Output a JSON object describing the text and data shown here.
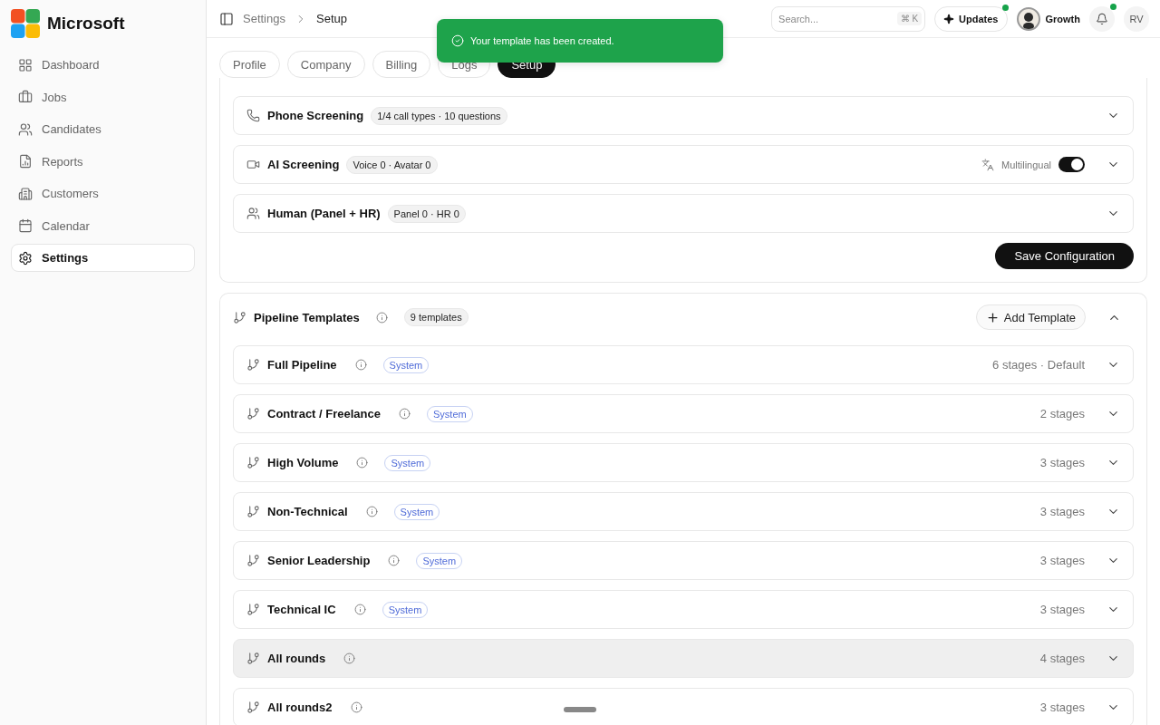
{
  "brand": "Microsoft",
  "sidebar": {
    "items": [
      {
        "label": "Dashboard",
        "selected": false
      },
      {
        "label": "Jobs",
        "selected": false
      },
      {
        "label": "Candidates",
        "selected": false
      },
      {
        "label": "Reports",
        "selected": false
      },
      {
        "label": "Customers",
        "selected": false
      },
      {
        "label": "Calendar",
        "selected": false
      },
      {
        "label": "Settings",
        "selected": true
      }
    ]
  },
  "header": {
    "breadcrumb": [
      "Settings",
      "Setup"
    ],
    "search": {
      "placeholder": "Search...",
      "shortcut": "⌘ K"
    },
    "updates": {
      "label": "Updates",
      "unread": true
    },
    "workspace": "Growth",
    "notifications_unread": true,
    "user_initials": "RV"
  },
  "toast": {
    "message": "Your template has been created."
  },
  "tabs": [
    {
      "label": "Profile",
      "selected": false
    },
    {
      "label": "Company",
      "selected": false
    },
    {
      "label": "Billing",
      "selected": false
    },
    {
      "label": "Logs",
      "selected": false
    },
    {
      "label": "Setup",
      "selected": true
    }
  ],
  "screening": {
    "rows": [
      {
        "kind": "plain",
        "title": "Phone Screening",
        "chip": "1/4 call types · 10 questions"
      },
      {
        "kind": "toggle",
        "title": "AI Screening",
        "chip": "Voice 0 · Avatar 0",
        "toggle_label": "Multilingual",
        "on": true
      },
      {
        "kind": "plain",
        "title": "Human (Panel + HR)",
        "chip": "Panel 0 · HR 0"
      }
    ],
    "save_button": "Save Configuration"
  },
  "pipeline": {
    "title": "Pipeline Templates",
    "count": "9 templates",
    "add_button": "Add Template",
    "expanded": true,
    "templates": [
      {
        "name": "Full Pipeline",
        "badge": "System",
        "meta": "6 stages · Default",
        "selected": false
      },
      {
        "name": "Contract / Freelance",
        "badge": "System",
        "meta": "2 stages",
        "selected": false
      },
      {
        "name": "High Volume",
        "badge": "System",
        "meta": "3 stages",
        "selected": false
      },
      {
        "name": "Non-Technical",
        "badge": "System",
        "meta": "3 stages",
        "selected": false
      },
      {
        "name": "Senior Leadership",
        "badge": "System",
        "meta": "3 stages",
        "selected": false
      },
      {
        "name": "Technical IC",
        "badge": "System",
        "meta": "3 stages",
        "selected": false
      },
      {
        "name": "All rounds",
        "meta": "4 stages",
        "selected": true
      },
      {
        "name": "All rounds2",
        "meta": "3 stages",
        "selected": false
      }
    ]
  }
}
